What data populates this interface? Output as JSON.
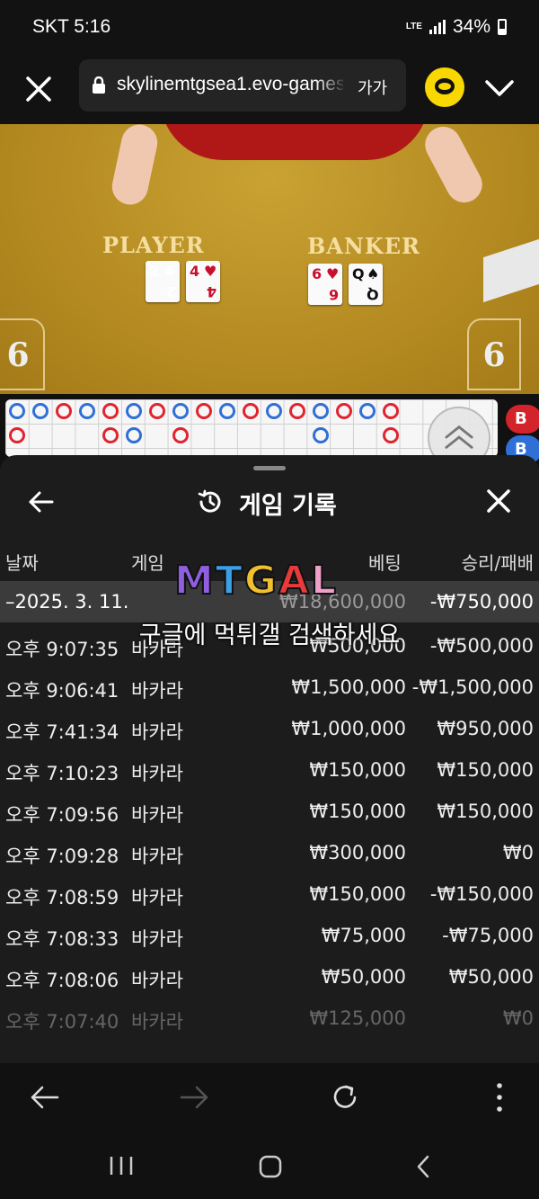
{
  "status_bar": {
    "time": "SKT 5:16",
    "network": "LTE",
    "battery": "34%"
  },
  "browser": {
    "url": "skylinemtgsea1.evo-games.com",
    "text_size_label": "가가"
  },
  "game": {
    "player_label": "PLAYER",
    "banker_label": "BANKER",
    "player_cards": [
      {
        "rank": "2",
        "suit": "♣",
        "color": "black"
      },
      {
        "rank": "4",
        "suit": "♥",
        "color": "red"
      }
    ],
    "banker_cards": [
      {
        "rank": "6",
        "suit": "♥",
        "color": "red"
      },
      {
        "rank": "Q",
        "suit": "♠",
        "color": "black"
      }
    ],
    "player_score": "6",
    "banker_score": "6",
    "side_labels": [
      "B",
      "B"
    ]
  },
  "history": {
    "title": "게임 기록",
    "columns": {
      "date": "날짜",
      "game": "게임",
      "bet": "베팅",
      "win_loss": "승리/패배"
    },
    "summary": {
      "date": "–2025. 3. 11.",
      "bet": "₩18,600,000",
      "win_loss": "-₩750,000"
    },
    "rows": [
      {
        "time": "오후 9:07:35",
        "game": "바카라",
        "bet": "₩500,000",
        "win_loss": "-₩500,000"
      },
      {
        "time": "오후 9:06:41",
        "game": "바카라",
        "bet": "₩1,500,000",
        "win_loss": "-₩1,500,000"
      },
      {
        "time": "오후 7:41:34",
        "game": "바카라",
        "bet": "₩1,000,000",
        "win_loss": "₩950,000"
      },
      {
        "time": "오후 7:10:23",
        "game": "바카라",
        "bet": "₩150,000",
        "win_loss": "₩150,000"
      },
      {
        "time": "오후 7:09:56",
        "game": "바카라",
        "bet": "₩150,000",
        "win_loss": "₩150,000"
      },
      {
        "time": "오후 7:09:28",
        "game": "바카라",
        "bet": "₩300,000",
        "win_loss": "₩0"
      },
      {
        "time": "오후 7:08:59",
        "game": "바카라",
        "bet": "₩150,000",
        "win_loss": "-₩150,000"
      },
      {
        "time": "오후 7:08:33",
        "game": "바카라",
        "bet": "₩75,000",
        "win_loss": "-₩75,000"
      },
      {
        "time": "오후 7:08:06",
        "game": "바카라",
        "bet": "₩50,000",
        "win_loss": "₩50,000"
      },
      {
        "time": "오후 7:07:40",
        "game": "바카라",
        "bet": "₩125,000",
        "win_loss": "₩0"
      }
    ]
  },
  "watermark": {
    "logo": "MTGAL",
    "text": "구글에 먹튀갤 검색하세요"
  },
  "colors": {
    "felt": "#b88c1e",
    "panel": "#1c1c1c",
    "banker_red": "#e0242f",
    "player_blue": "#2f6fd6",
    "kakao_yellow": "#f8d800"
  }
}
